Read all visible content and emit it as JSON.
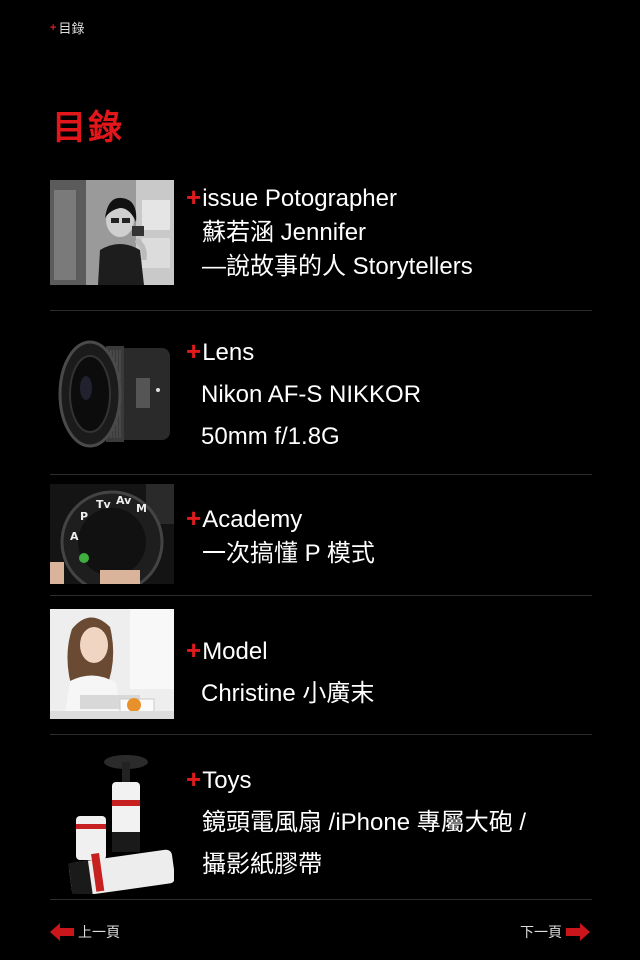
{
  "breadcrumb": {
    "plus": "+",
    "label": "目錄"
  },
  "page_title": "目錄",
  "entries": [
    {
      "plus": "+",
      "heading": "issue Potographer",
      "lines": [
        "蘇若涵 Jennifer",
        "—說故事的人 Storytellers"
      ],
      "thumb": "photographer-portrait"
    },
    {
      "plus": "+",
      "heading": "Lens",
      "lines": [
        "Nikon AF-S NIKKOR",
        "50mm f/1.8G"
      ],
      "thumb": "camera-lens"
    },
    {
      "plus": "+",
      "heading": "Academy",
      "lines": [
        "一次搞懂 P 模式"
      ],
      "thumb": "mode-dial"
    },
    {
      "plus": "+",
      "heading": "Model",
      "lines": [
        "Christine 小廣末"
      ],
      "thumb": "model-portrait"
    },
    {
      "plus": "+",
      "heading": "Toys",
      "lines": [
        "鏡頭電風扇 /iPhone 專屬大砲 /",
        "攝影紙膠帶"
      ],
      "thumb": "lens-toys"
    }
  ],
  "nav": {
    "prev_label": "上一頁",
    "next_label": "下一頁"
  },
  "colors": {
    "accent": "#e3161a",
    "background": "#000000",
    "text": "#ffffff"
  }
}
